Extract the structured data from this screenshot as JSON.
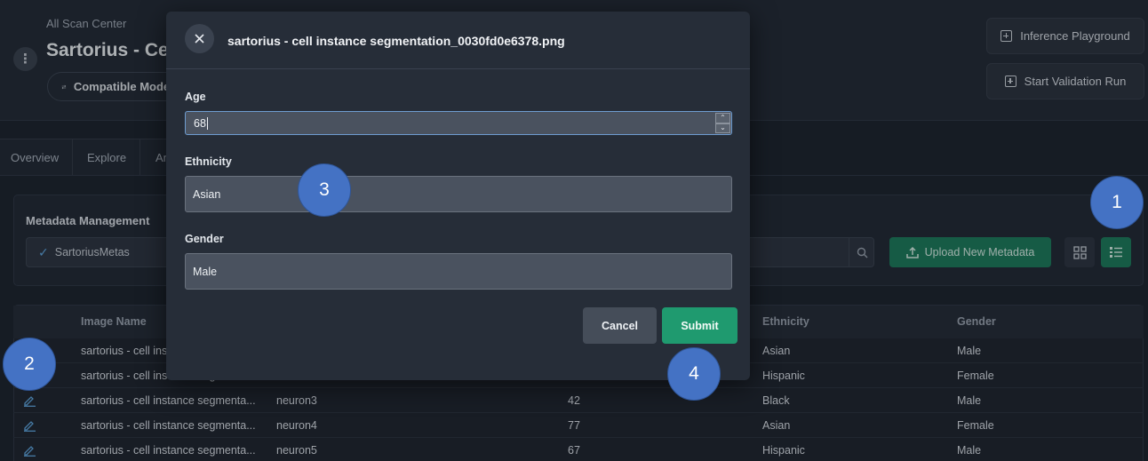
{
  "header": {
    "breadcrumb": "All Scan Center",
    "title": "Sartorius - Cell instance segmentation",
    "compatible_label": "Compatible Models",
    "inference_label": "Inference Playground",
    "validation_label": "Start Validation Run"
  },
  "tabs": [
    "Overview",
    "Explore",
    "An"
  ],
  "metadata": {
    "title": "Metadata Management",
    "selected": "SartoriusMetas",
    "upload_label": "Upload New Metadata"
  },
  "table": {
    "columns": [
      "Image Name",
      "Ethnicity",
      "Gender"
    ],
    "rows": [
      {
        "image": "sartorius - cell instance segmenta...",
        "id": "",
        "age": "",
        "ethnicity": "Asian",
        "gender": "Male"
      },
      {
        "image": "sartorius - cell instance segmenta...",
        "id": "",
        "age": "",
        "ethnicity": "Hispanic",
        "gender": "Female"
      },
      {
        "image": "sartorius - cell instance segmenta...",
        "id": "neuron3",
        "age": "42",
        "ethnicity": "Black",
        "gender": "Male"
      },
      {
        "image": "sartorius - cell instance segmenta...",
        "id": "neuron4",
        "age": "77",
        "ethnicity": "Asian",
        "gender": "Female"
      },
      {
        "image": "sartorius - cell instance segmenta...",
        "id": "neuron5",
        "age": "67",
        "ethnicity": "Hispanic",
        "gender": "Male"
      }
    ]
  },
  "modal": {
    "title": "sartorius - cell instance segmentation_0030fd0e6378.png",
    "age_label": "Age",
    "age_value": "68",
    "ethnicity_label": "Ethnicity",
    "ethnicity_value": "Asian",
    "gender_label": "Gender",
    "gender_value": "Male",
    "cancel_label": "Cancel",
    "submit_label": "Submit"
  },
  "markers": [
    "1",
    "2",
    "3",
    "4"
  ],
  "colors": {
    "accent_green": "#1f9a6f",
    "marker_blue": "#4472c4",
    "background": "#1d232d"
  }
}
